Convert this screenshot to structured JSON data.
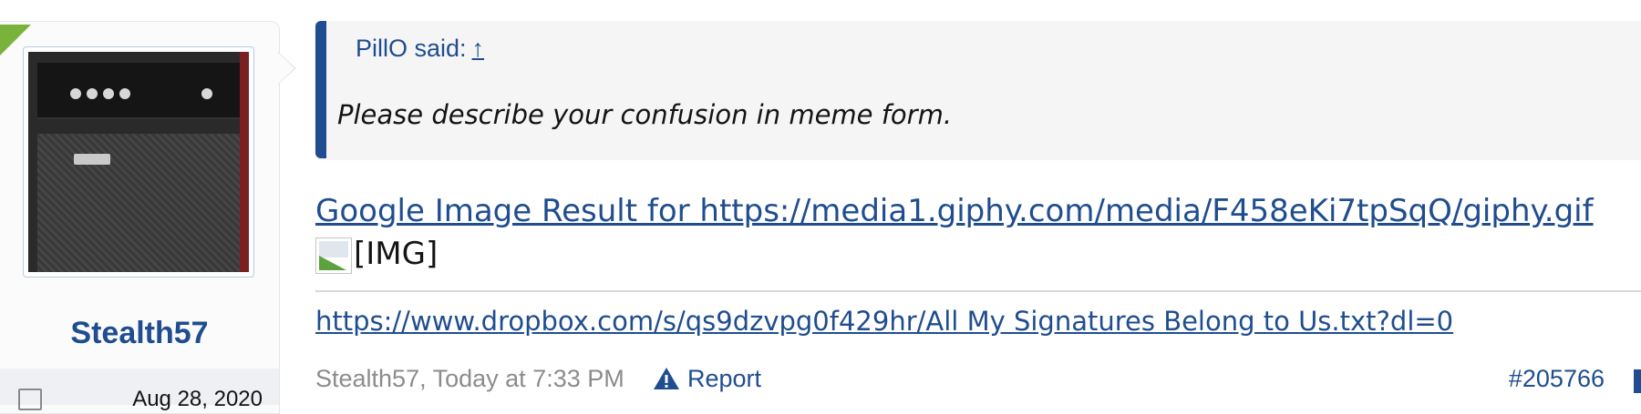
{
  "user": {
    "name": "Stealth57",
    "join_date": "Aug 28, 2020",
    "avatar_icon": "amplifier-avatar",
    "calendar_icon": "calendar-icon"
  },
  "quote": {
    "author": "PillO said:",
    "arrow": "↑",
    "text": "Please describe your confusion in meme form."
  },
  "post": {
    "link_text": "Google Image Result for https://media1.giphy.com/media/F458eKi7tpSqQ/giphy.gif",
    "image_alt": "[IMG]",
    "signature_link": "https://www.dropbox.com/s/qs9dzvpg0f429hr/All My Signatures Belong to Us.txt?dl=0"
  },
  "footer": {
    "author": "Stealth57",
    "separator": ", ",
    "time": "Today at 7:33 PM",
    "report_label": "Report",
    "post_number": "#205766"
  },
  "colors": {
    "accent": "#1f4d8f",
    "flag": "#7ab33c",
    "muted": "#8c8c8c"
  }
}
